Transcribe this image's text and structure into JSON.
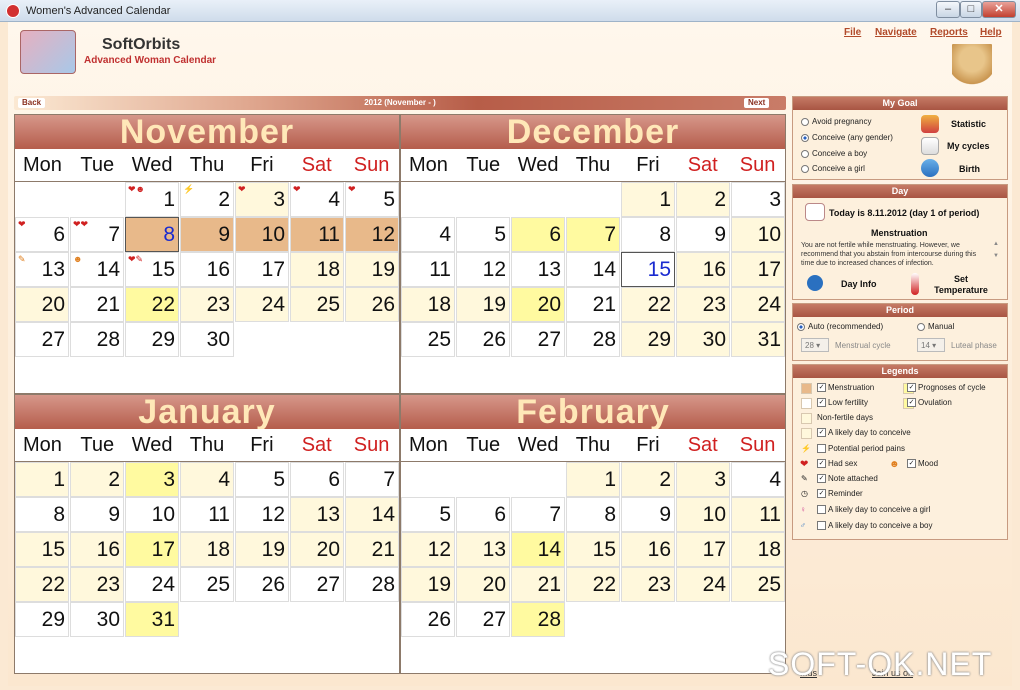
{
  "window": {
    "title": "Women's Advanced Calendar"
  },
  "brand": {
    "name": "SoftOrbits",
    "subtitle": "Advanced Woman Calendar"
  },
  "menu": [
    "File",
    "Navigate",
    "Reports",
    "Help"
  ],
  "nav": {
    "back": "Back",
    "next": "Next",
    "title": "2012 (November - )"
  },
  "weekdays": [
    "Mon",
    "Tue",
    "Wed",
    "Thu",
    "Fri",
    "Sat",
    "Sun"
  ],
  "months": [
    {
      "name": "November",
      "start": 3,
      "days": 30,
      "colors": {
        "1": "white",
        "2": "white",
        "3": "cream",
        "4": "white",
        "5": "white",
        "6": "white",
        "7": "white",
        "8": "mens",
        "9": "mens",
        "10": "mens",
        "11": "mens",
        "12": "mens",
        "13": "white",
        "14": "white",
        "15": "white",
        "16": "white",
        "17": "white",
        "18": "cream",
        "19": "cream",
        "20": "cream",
        "21": "white",
        "22": "yellow",
        "23": "cream",
        "24": "cream",
        "25": "cream",
        "26": "cream",
        "27": "white",
        "28": "white",
        "29": "white",
        "30": "white"
      },
      "marks": {
        "1": "❤☻",
        "2": "⚡",
        "3": "❤",
        "4": "❤",
        "5": "❤",
        "6": "❤",
        "7": "❤❤",
        "13": "✎",
        "14": "☻",
        "15": "❤✎"
      },
      "selected": 8
    },
    {
      "name": "December",
      "start": 5,
      "days": 31,
      "colors": {
        "1": "cream",
        "2": "cream",
        "3": "white",
        "4": "white",
        "5": "white",
        "6": "yellow",
        "7": "yellow",
        "8": "white",
        "9": "white",
        "10": "cream",
        "11": "white",
        "12": "white",
        "13": "white",
        "14": "white",
        "15": "white",
        "16": "cream",
        "17": "cream",
        "18": "cream",
        "19": "cream",
        "20": "yellow",
        "21": "white",
        "22": "cream",
        "23": "cream",
        "24": "cream",
        "25": "white",
        "26": "white",
        "27": "white",
        "28": "white",
        "29": "cream",
        "30": "cream",
        "31": "cream"
      },
      "marks": {},
      "selected": 15
    },
    {
      "name": "January",
      "start": 1,
      "days": 31,
      "colors": {
        "1": "cream",
        "2": "cream",
        "3": "yellow",
        "4": "cream",
        "5": "white",
        "6": "white",
        "7": "white",
        "8": "white",
        "9": "white",
        "10": "white",
        "11": "white",
        "12": "white",
        "13": "cream",
        "14": "cream",
        "15": "cream",
        "16": "cream",
        "17": "yellow",
        "18": "cream",
        "19": "cream",
        "20": "cream",
        "21": "cream",
        "22": "cream",
        "23": "cream",
        "24": "white",
        "25": "white",
        "26": "white",
        "27": "white",
        "28": "white",
        "29": "white",
        "30": "white",
        "31": "yellow"
      },
      "marks": {},
      "selected": null
    },
    {
      "name": "February",
      "start": 4,
      "days": 28,
      "colors": {
        "1": "cream",
        "2": "cream",
        "3": "cream",
        "4": "white",
        "5": "white",
        "6": "white",
        "7": "white",
        "8": "white",
        "9": "white",
        "10": "cream",
        "11": "cream",
        "12": "cream",
        "13": "cream",
        "14": "yellow",
        "15": "cream",
        "16": "cream",
        "17": "cream",
        "18": "cream",
        "19": "cream",
        "20": "cream",
        "21": "cream",
        "22": "cream",
        "23": "cream",
        "24": "cream",
        "25": "cream",
        "26": "white",
        "27": "white",
        "28": "yellow"
      },
      "marks": {},
      "selected": null
    }
  ],
  "goal": {
    "header": "My Goal",
    "options": [
      "Avoid pregnancy",
      "Conceive (any gender)",
      "Conceive a boy",
      "Conceive a girl"
    ],
    "selected": 1,
    "buttons": [
      "Statistic",
      "My cycles",
      "Birth"
    ]
  },
  "day": {
    "header": "Day",
    "today": "Today is 8.11.2012 (day 1 of period)",
    "section": "Menstruation",
    "text": "You are not fertile while menstruating. However, we recommend that you abstain from intercourse during this time due to increased chances of infection.",
    "day_info": "Day Info",
    "set_temp": "Set Temperature"
  },
  "period": {
    "header": "Period",
    "auto": "Auto (recommended)",
    "manual": "Manual",
    "cycle_value": "28",
    "cycle_label": "Menstrual cycle",
    "luteal_value": "14",
    "luteal_label": "Luteal phase"
  },
  "legends": {
    "header": "Legends",
    "items": [
      "Menstruation",
      "Prognoses of cycle",
      "Low fertility",
      "Ovulation",
      "Non-fertile days",
      "A likely day to conceive",
      "Potential period pains",
      "Had sex",
      "Mood",
      "Note attached",
      "Reminder",
      "A likely day to conceive a girl",
      "A likely day to conceive a boy"
    ]
  },
  "colors": {
    "mens": "#e8b98a",
    "cream": "#fff8dc",
    "yellow": "#fffaa0",
    "header": "#b55d4c"
  },
  "footer": {
    "left": "...us",
    "right": "Join us on"
  },
  "watermark": "SOFT-OK.NET"
}
